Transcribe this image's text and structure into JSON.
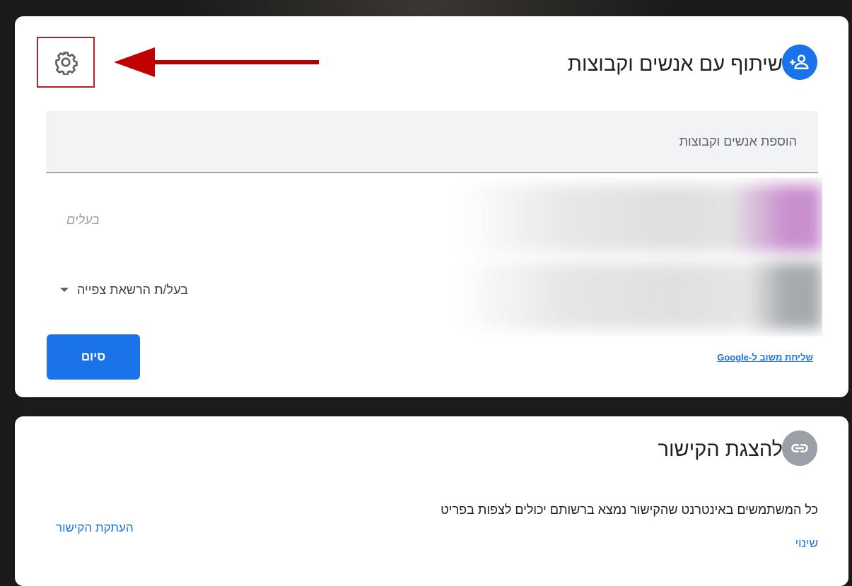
{
  "share": {
    "title": "שיתוף עם אנשים וקבוצות",
    "add_placeholder": "הוספת אנשים וקבוצות",
    "owners_label": "בעלים",
    "permission_label": "בעל/ת הרשאת צפייה",
    "done_label": "סיום",
    "feedback_label": "שליחת משוב ל-Google",
    "icons": {
      "header": "add-person-icon",
      "settings": "gear-icon",
      "permission_caret": "caret-down-icon"
    }
  },
  "link": {
    "title": "להצגת הקישור",
    "description": "כל המשתמשים באינטרנט שהקישור נמצא ברשותם יכולים לצפות בפריט",
    "change_label": "שינוי",
    "copy_label": "העתקת הקישור",
    "icons": {
      "header": "link-icon"
    }
  },
  "colors": {
    "accent": "#1a73e8",
    "share_avatar": "#1a73e8",
    "link_avatar": "#9aa0a6",
    "annotation": "#c00000"
  }
}
